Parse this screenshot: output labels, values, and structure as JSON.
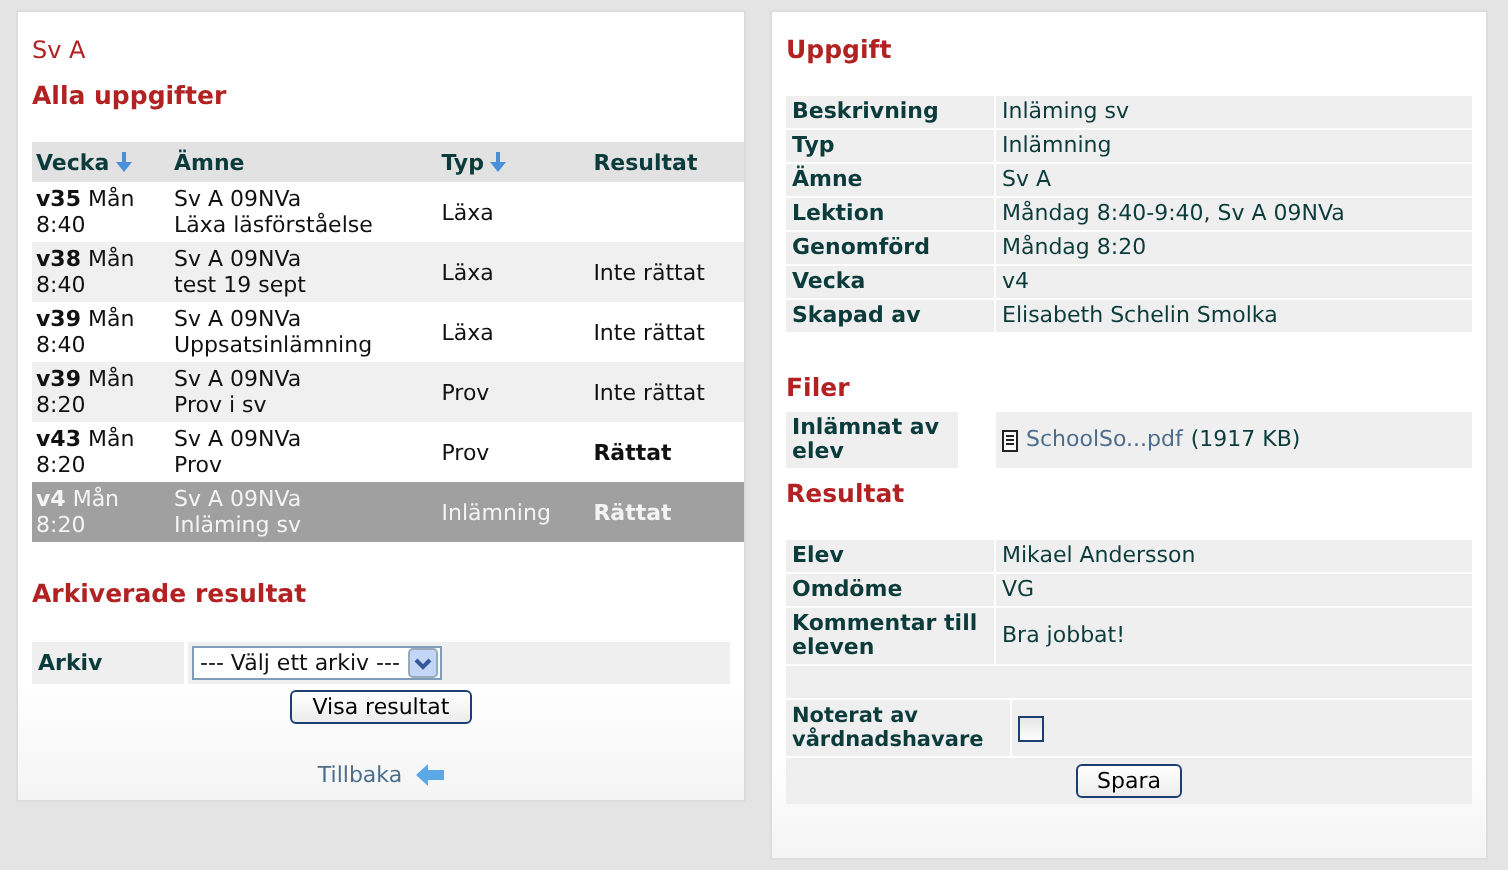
{
  "left": {
    "course": "Sv A",
    "heading": "Alla uppgifter",
    "columns": [
      {
        "label": "Vecka",
        "sorted": true
      },
      {
        "label": "Ämne",
        "sorted": false
      },
      {
        "label": "Typ",
        "sorted": true
      },
      {
        "label": "Resultat",
        "sorted": false
      }
    ],
    "rows": [
      {
        "week": "v35",
        "day": "Mån",
        "time": "8:40",
        "subject": "Sv A 09NVa",
        "title": "Läxa läsförståelse",
        "type": "Läxa",
        "selected": false
      },
      {
        "week": "v38",
        "day": "Mån",
        "time": "8:40",
        "subject": "Sv A 09NVa",
        "title": "test 19 sept",
        "type": "Läxa",
        "result": "Inte rättat",
        "result_bold": false,
        "selected": false
      },
      {
        "week": "v39",
        "day": "Mån",
        "time": "8:40",
        "subject": "Sv A 09NVa",
        "title": "Uppsatsinlämning",
        "type": "Läxa",
        "result": "Inte rättat",
        "result_bold": false,
        "selected": false
      },
      {
        "week": "v39",
        "day": "Mån",
        "time": "8:20",
        "subject": "Sv A 09NVa",
        "title": "Prov i sv",
        "type": "Prov",
        "result": "Inte rättat",
        "result_bold": false,
        "selected": false
      },
      {
        "week": "v43",
        "day": "Mån",
        "time": "8:20",
        "subject": "Sv A 09NVa",
        "title": "Prov",
        "type": "Prov",
        "result": "Rättat",
        "result_bold": true,
        "selected": false
      },
      {
        "week": "v4",
        "day": "Mån",
        "time": "8:20",
        "subject": "Sv A 09NVa",
        "title": "Inläming sv",
        "type": "Inlämning",
        "result": "Rättat",
        "result_bold": true,
        "selected": true
      }
    ],
    "archive": {
      "heading": "Arkiverade resultat",
      "label": "Arkiv",
      "select_value": "--- Välj ett arkiv ---",
      "button": "Visa resultat"
    },
    "back_link": "Tillbaka"
  },
  "right": {
    "task_heading": "Uppgift",
    "task": [
      {
        "label": "Beskrivning",
        "value": "Inläming sv"
      },
      {
        "label": "Typ",
        "value": "Inlämning"
      },
      {
        "label": "Ämne",
        "value": "Sv A"
      },
      {
        "label": "Lektion",
        "value": "Måndag 8:40-9:40, Sv A 09NVa"
      },
      {
        "label": "Genomförd",
        "value": "Måndag 8:20"
      },
      {
        "label": "Vecka",
        "value": "v4"
      },
      {
        "label": "Skapad av",
        "value": "Elisabeth Schelin Smolka"
      }
    ],
    "files_heading": "Filer",
    "file": {
      "label": "Inlämnat av elev",
      "name": "SchoolSo...pdf",
      "size": "(1917 KB)"
    },
    "result_heading": "Resultat",
    "result": [
      {
        "label": "Elev",
        "value": "Mikael Andersson"
      },
      {
        "label": "Omdöme",
        "value": "VG"
      },
      {
        "label": "Kommentar till eleven",
        "value": "Bra jobbat!"
      }
    ],
    "guardian": {
      "label": "Noterat av vårdnadshavare",
      "checked": false
    },
    "save_button": "Spara"
  }
}
